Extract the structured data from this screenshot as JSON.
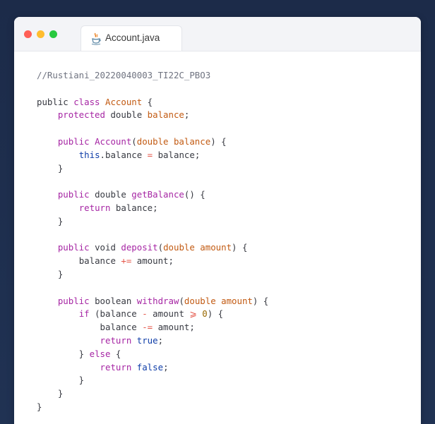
{
  "window": {
    "tab_title": "Account.java",
    "tab_icon": "java-icon",
    "traffic_lights": [
      "#ff5f56",
      "#ffbd2e",
      "#27c93f"
    ]
  },
  "code": {
    "lines": [
      [
        {
          "t": "//Rustiani_20220040003_TI22C_PBO3",
          "c": "comment"
        }
      ],
      [],
      [
        {
          "t": "public ",
          "c": "ident"
        },
        {
          "t": "class ",
          "c": "keyword"
        },
        {
          "t": "Account",
          "c": "field"
        },
        {
          "t": " {",
          "c": "punct"
        }
      ],
      [
        {
          "t": "    ",
          "c": "punct"
        },
        {
          "t": "protected ",
          "c": "keyword"
        },
        {
          "t": "double ",
          "c": "ident"
        },
        {
          "t": "balance",
          "c": "field"
        },
        {
          "t": ";",
          "c": "punct"
        }
      ],
      [],
      [
        {
          "t": "    ",
          "c": "punct"
        },
        {
          "t": "public ",
          "c": "keyword"
        },
        {
          "t": "Account",
          "c": "call"
        },
        {
          "t": "(",
          "c": "punct"
        },
        {
          "t": "double ",
          "c": "field"
        },
        {
          "t": "balance",
          "c": "field"
        },
        {
          "t": ") {",
          "c": "punct"
        }
      ],
      [
        {
          "t": "        ",
          "c": "punct"
        },
        {
          "t": "this",
          "c": "this"
        },
        {
          "t": ".balance ",
          "c": "ident"
        },
        {
          "t": "=",
          "c": "op"
        },
        {
          "t": " balance;",
          "c": "ident"
        }
      ],
      [
        {
          "t": "    }",
          "c": "punct"
        }
      ],
      [],
      [
        {
          "t": "    ",
          "c": "punct"
        },
        {
          "t": "public ",
          "c": "keyword"
        },
        {
          "t": "double ",
          "c": "ident"
        },
        {
          "t": "getBalance",
          "c": "call"
        },
        {
          "t": "() {",
          "c": "punct"
        }
      ],
      [
        {
          "t": "        ",
          "c": "punct"
        },
        {
          "t": "return ",
          "c": "ret"
        },
        {
          "t": "balance;",
          "c": "ident"
        }
      ],
      [
        {
          "t": "    }",
          "c": "punct"
        }
      ],
      [],
      [
        {
          "t": "    ",
          "c": "punct"
        },
        {
          "t": "public ",
          "c": "keyword"
        },
        {
          "t": "void ",
          "c": "ident"
        },
        {
          "t": "deposit",
          "c": "call"
        },
        {
          "t": "(",
          "c": "punct"
        },
        {
          "t": "double ",
          "c": "field"
        },
        {
          "t": "amount",
          "c": "field"
        },
        {
          "t": ") {",
          "c": "punct"
        }
      ],
      [
        {
          "t": "        ",
          "c": "punct"
        },
        {
          "t": "balance ",
          "c": "ident"
        },
        {
          "t": "+=",
          "c": "op"
        },
        {
          "t": " amount;",
          "c": "ident"
        }
      ],
      [
        {
          "t": "    }",
          "c": "punct"
        }
      ],
      [],
      [
        {
          "t": "    ",
          "c": "punct"
        },
        {
          "t": "public ",
          "c": "keyword"
        },
        {
          "t": "boolean ",
          "c": "ident"
        },
        {
          "t": "withdraw",
          "c": "call"
        },
        {
          "t": "(",
          "c": "punct"
        },
        {
          "t": "double ",
          "c": "field"
        },
        {
          "t": "amount",
          "c": "field"
        },
        {
          "t": ") {",
          "c": "punct"
        }
      ],
      [
        {
          "t": "        ",
          "c": "punct"
        },
        {
          "t": "if ",
          "c": "keyword"
        },
        {
          "t": "(balance ",
          "c": "ident"
        },
        {
          "t": "-",
          "c": "op"
        },
        {
          "t": " amount ",
          "c": "ident"
        },
        {
          "t": "⩾",
          "c": "op"
        },
        {
          "t": " ",
          "c": "ident"
        },
        {
          "t": "0",
          "c": "num"
        },
        {
          "t": ") {",
          "c": "punct"
        }
      ],
      [
        {
          "t": "            ",
          "c": "punct"
        },
        {
          "t": "balance ",
          "c": "ident"
        },
        {
          "t": "-=",
          "c": "op"
        },
        {
          "t": " amount;",
          "c": "ident"
        }
      ],
      [
        {
          "t": "            ",
          "c": "punct"
        },
        {
          "t": "return ",
          "c": "ret"
        },
        {
          "t": "true",
          "c": "this"
        },
        {
          "t": ";",
          "c": "punct"
        }
      ],
      [
        {
          "t": "        } ",
          "c": "punct"
        },
        {
          "t": "else",
          "c": "keyword"
        },
        {
          "t": " {",
          "c": "punct"
        }
      ],
      [
        {
          "t": "            ",
          "c": "punct"
        },
        {
          "t": "return ",
          "c": "ret"
        },
        {
          "t": "false",
          "c": "this"
        },
        {
          "t": ";",
          "c": "punct"
        }
      ],
      [
        {
          "t": "        }",
          "c": "punct"
        }
      ],
      [
        {
          "t": "    }",
          "c": "punct"
        }
      ],
      [
        {
          "t": "}",
          "c": "punct"
        }
      ]
    ]
  }
}
